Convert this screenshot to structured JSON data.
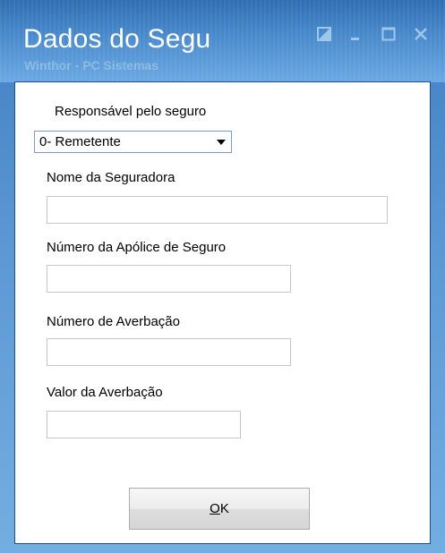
{
  "window": {
    "title": "Dados do Segu",
    "subtitle": "Winthor - PC Sistemas"
  },
  "titlebar_controls": [
    {
      "name": "restore-icon"
    },
    {
      "name": "minimize-icon"
    },
    {
      "name": "maximize-icon"
    },
    {
      "name": "close-icon"
    }
  ],
  "form": {
    "responsavel_label": "Responsável pelo seguro",
    "responsavel_value": "0- Remetente",
    "seguradora_label": "Nome da Seguradora",
    "seguradora_value": "",
    "apolice_label": "Número da Apólice de Seguro",
    "apolice_value": "",
    "averbacao_label": "Número de Averbação",
    "averbacao_value": "",
    "valor_label": "Valor da Averbação",
    "valor_value": ""
  },
  "buttons": {
    "ok_mnemonic": "O",
    "ok_rest": "K"
  },
  "colors": {
    "titlebar": "#3f7ec1",
    "window_frame": "#5c98d4",
    "control_glyph": "#9fc7ea"
  }
}
